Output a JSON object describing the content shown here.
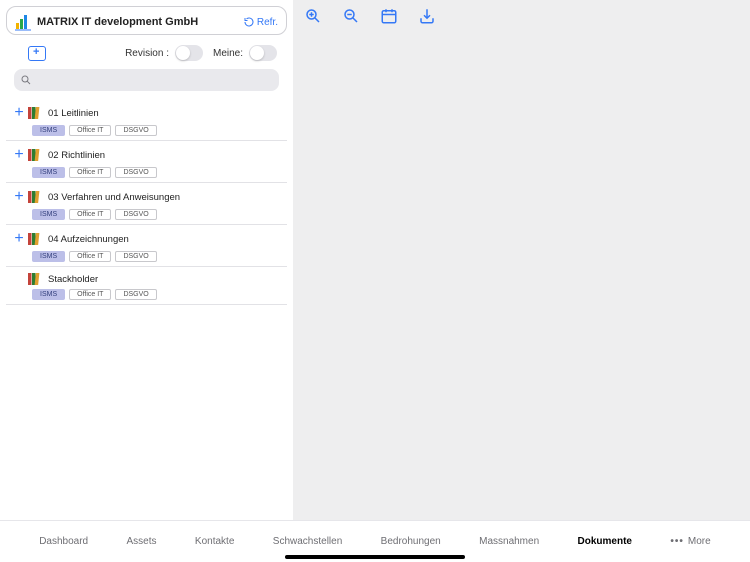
{
  "header": {
    "title": "MATRIX IT development GmbH",
    "refresh_label": "Refr."
  },
  "controls": {
    "revision_label": "Revision :",
    "revision_on": false,
    "mine_label": "Meine:",
    "mine_on": false
  },
  "search": {
    "placeholder": ""
  },
  "tree": [
    {
      "name": "01 Leitlinien",
      "expandable": true,
      "tags": [
        "ISMS",
        "Office IT",
        "DSGVO"
      ]
    },
    {
      "name": "02 Richtlinien",
      "expandable": true,
      "tags": [
        "ISMS",
        "Office IT",
        "DSGVO"
      ]
    },
    {
      "name": "03 Verfahren und Anweisungen",
      "expandable": true,
      "tags": [
        "ISMS",
        "Office IT",
        "DSGVO"
      ]
    },
    {
      "name": "04 Aufzeichnungen",
      "expandable": true,
      "tags": [
        "ISMS",
        "Office IT",
        "DSGVO"
      ]
    },
    {
      "name": "Stackholder",
      "expandable": false,
      "tags": [
        "ISMS",
        "Office IT",
        "DSGVO"
      ]
    }
  ],
  "viewer_toolbar": {
    "icons": [
      "zoom-in-icon",
      "zoom-out-icon",
      "calendar-icon",
      "download-icon"
    ]
  },
  "tabs": {
    "items": [
      "Dashboard",
      "Assets",
      "Kontakte",
      "Schwachstellen",
      "Bedrohungen",
      "Massnahmen",
      "Dokumente"
    ],
    "more_label": "More",
    "active": "Dokumente"
  }
}
